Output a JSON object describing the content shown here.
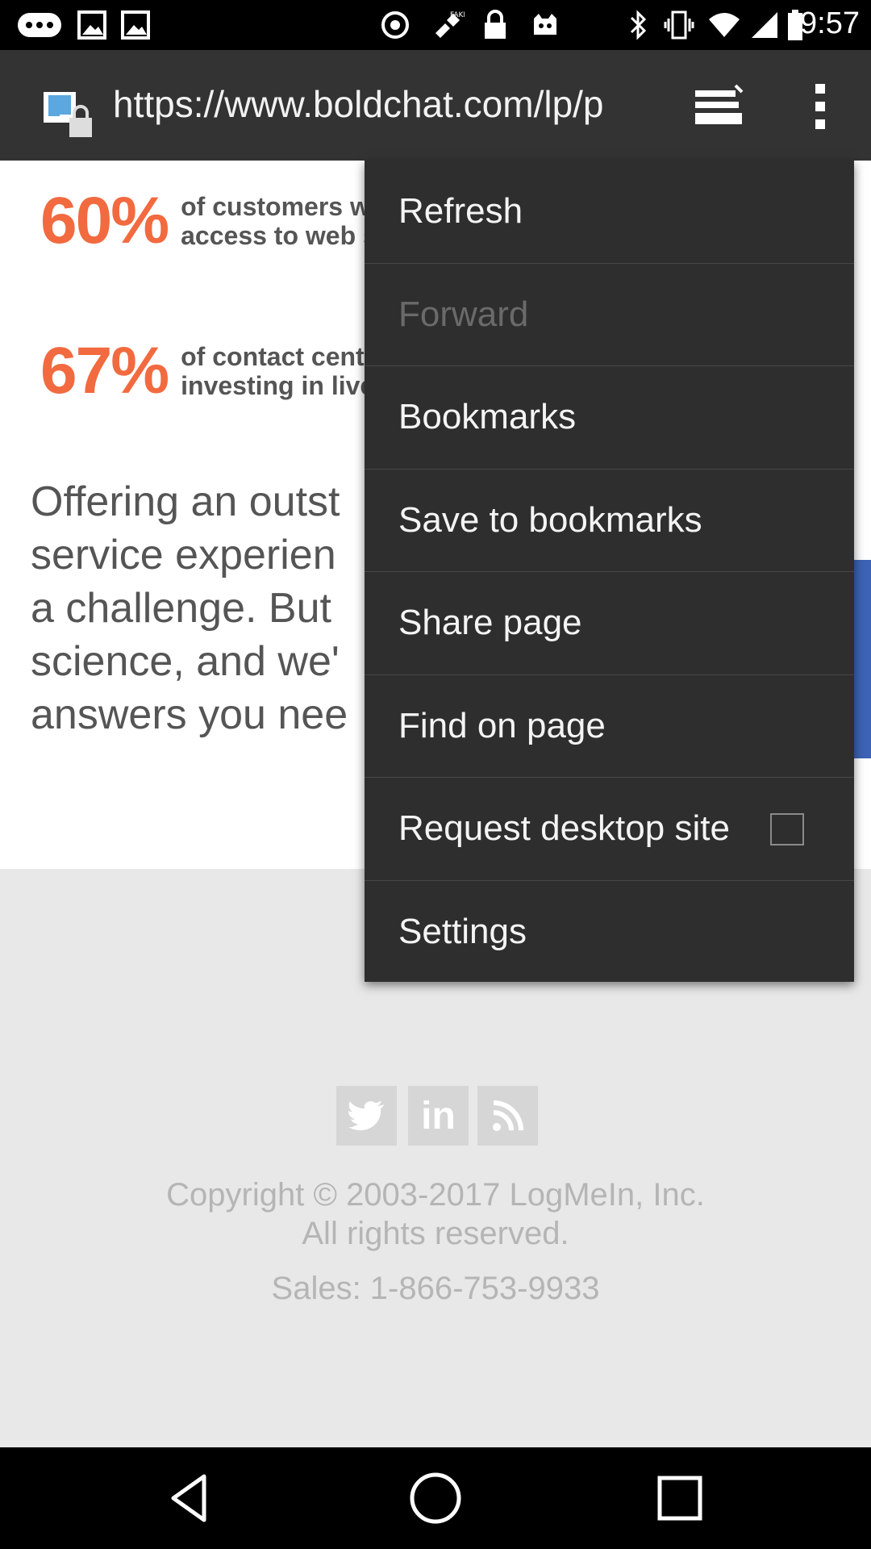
{
  "status_bar": {
    "time": "9:57",
    "left_icons": [
      "messages-icon",
      "image-icon",
      "image-icon",
      "blocked-icon",
      "fake-gps-icon",
      "lock-icon",
      "mascot-icon"
    ],
    "right_icons": [
      "bluetooth-icon",
      "vibrate-icon",
      "wifi-icon",
      "signal-icon",
      "battery-icon"
    ]
  },
  "toolbar": {
    "url": "https://www.boldchat.com/lp/p"
  },
  "page": {
    "stat1": {
      "number": "60%",
      "text": "of customers w\naccess to web s"
    },
    "stat2": {
      "number": "67%",
      "text": "of contact cente\ninvesting in live"
    },
    "intro": "Offering an outst\nservice experien\na challenge. But\nscience, and we'\nanswers you nee",
    "social": {
      "twitter": "t",
      "linkedin": "in"
    },
    "copyright": "Copyright © 2003-2017 LogMeIn, Inc.",
    "rights": "All rights reserved.",
    "sales": "Sales: 1-866-753-9933"
  },
  "menu": {
    "items": [
      {
        "label": "Refresh"
      },
      {
        "label": "Forward"
      },
      {
        "label": "Bookmarks"
      },
      {
        "label": "Save to bookmarks"
      },
      {
        "label": "Share page"
      },
      {
        "label": "Find on page"
      },
      {
        "label": "Request desktop site",
        "checked": false
      },
      {
        "label": "Settings"
      }
    ]
  },
  "colors": {
    "accent_orange": "#f26a3f",
    "toolbar_bg": "#333333",
    "menu_bg": "#2e2e2e",
    "blue_tab": "#3c63b5"
  }
}
